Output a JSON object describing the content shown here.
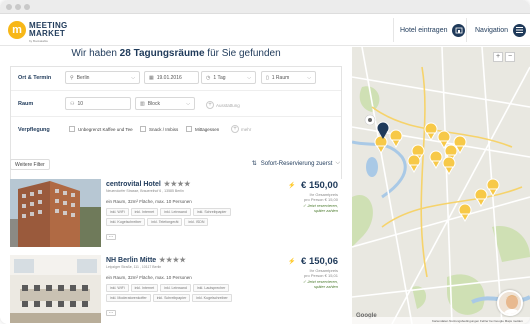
{
  "header": {
    "logo_letter": "m",
    "logo_line1": "MEETING",
    "logo_line2": "MARKET",
    "logo_sub": "by Bookatable",
    "add_listing_label": "Hotel eintragen",
    "navigation_label": "Navigation"
  },
  "search": {
    "headline_prefix": "Wir haben ",
    "headline_count": "28 Tagungsräume",
    "headline_suffix": " für Sie gefunden"
  },
  "filters": {
    "row1_label": "Ort & Termin",
    "city": "Berlin",
    "date": "19.01.2016",
    "duration": "1 Tag",
    "rooms": "1 Raum",
    "row2_label": "Raum",
    "persons": "10",
    "seating": "Block",
    "add_equipment": "Ausstattung",
    "row3_label": "Verpflegung",
    "catering_options": [
      "Unbegrenzt Kaffee und Tee",
      "Snack / Imbiss",
      "Mittagessen"
    ],
    "add_more": "mehr"
  },
  "toolbar": {
    "more_filters": "Weitere Filter",
    "sort_label": "Sofort-Reservierung zuerst"
  },
  "listings": [
    {
      "name": "centrovital Hotel",
      "stars": "★★★★",
      "address": "Neuendorfer Strasse, Brauereihof 6 , 13585 Berlin",
      "description": "ein Raum, 32m² Fläche, max. 10 Personen",
      "tags": [
        "inkl. WiFi",
        "inkl. Internet",
        "inkl. Leinwand",
        "inkl. Schreibpapier",
        "inkl. Kugelschreiber",
        "inkl. Telefongerät",
        "inkl. ISDN"
      ],
      "more": "…",
      "price": "€ 150,00",
      "price_note1": "Ihr Gesamtpreis",
      "price_note2": "pro Person € 15,00",
      "status1": "✓ Jetzt reservieren,",
      "status2": "später zahlen"
    },
    {
      "name": "NH Berlin Mitte",
      "stars": "★★★★",
      "address": "Leipziger Straße, 111 , 10117 Berlin",
      "description": "ein Raum, 32m² Fläche, max. 10 Personen",
      "tags": [
        "inkl. WiFi",
        "inkl. Internet",
        "inkl. Leinwand",
        "inkl. Lautsprecher",
        "inkl. Moderatorenkoffer",
        "inkl. Schreibpapier",
        "inkl. Kugelschreiber"
      ],
      "more": "…",
      "price": "€ 150,06",
      "price_note1": "Ihr Gesamtpreis",
      "price_note2": "pro Person € 15,01",
      "status1": "✓ Jetzt reservieren,",
      "status2": "später zahlen"
    }
  ],
  "map": {
    "zoom_in": "+",
    "zoom_out": "−",
    "brand": "Google",
    "footer_text": "Kartendaten    Nutzungsbedingungen    Fehler bei Google Maps melden"
  },
  "colors": {
    "accent": "#f7b718",
    "navy": "#1f3a5a",
    "marker": "#f7c948"
  }
}
